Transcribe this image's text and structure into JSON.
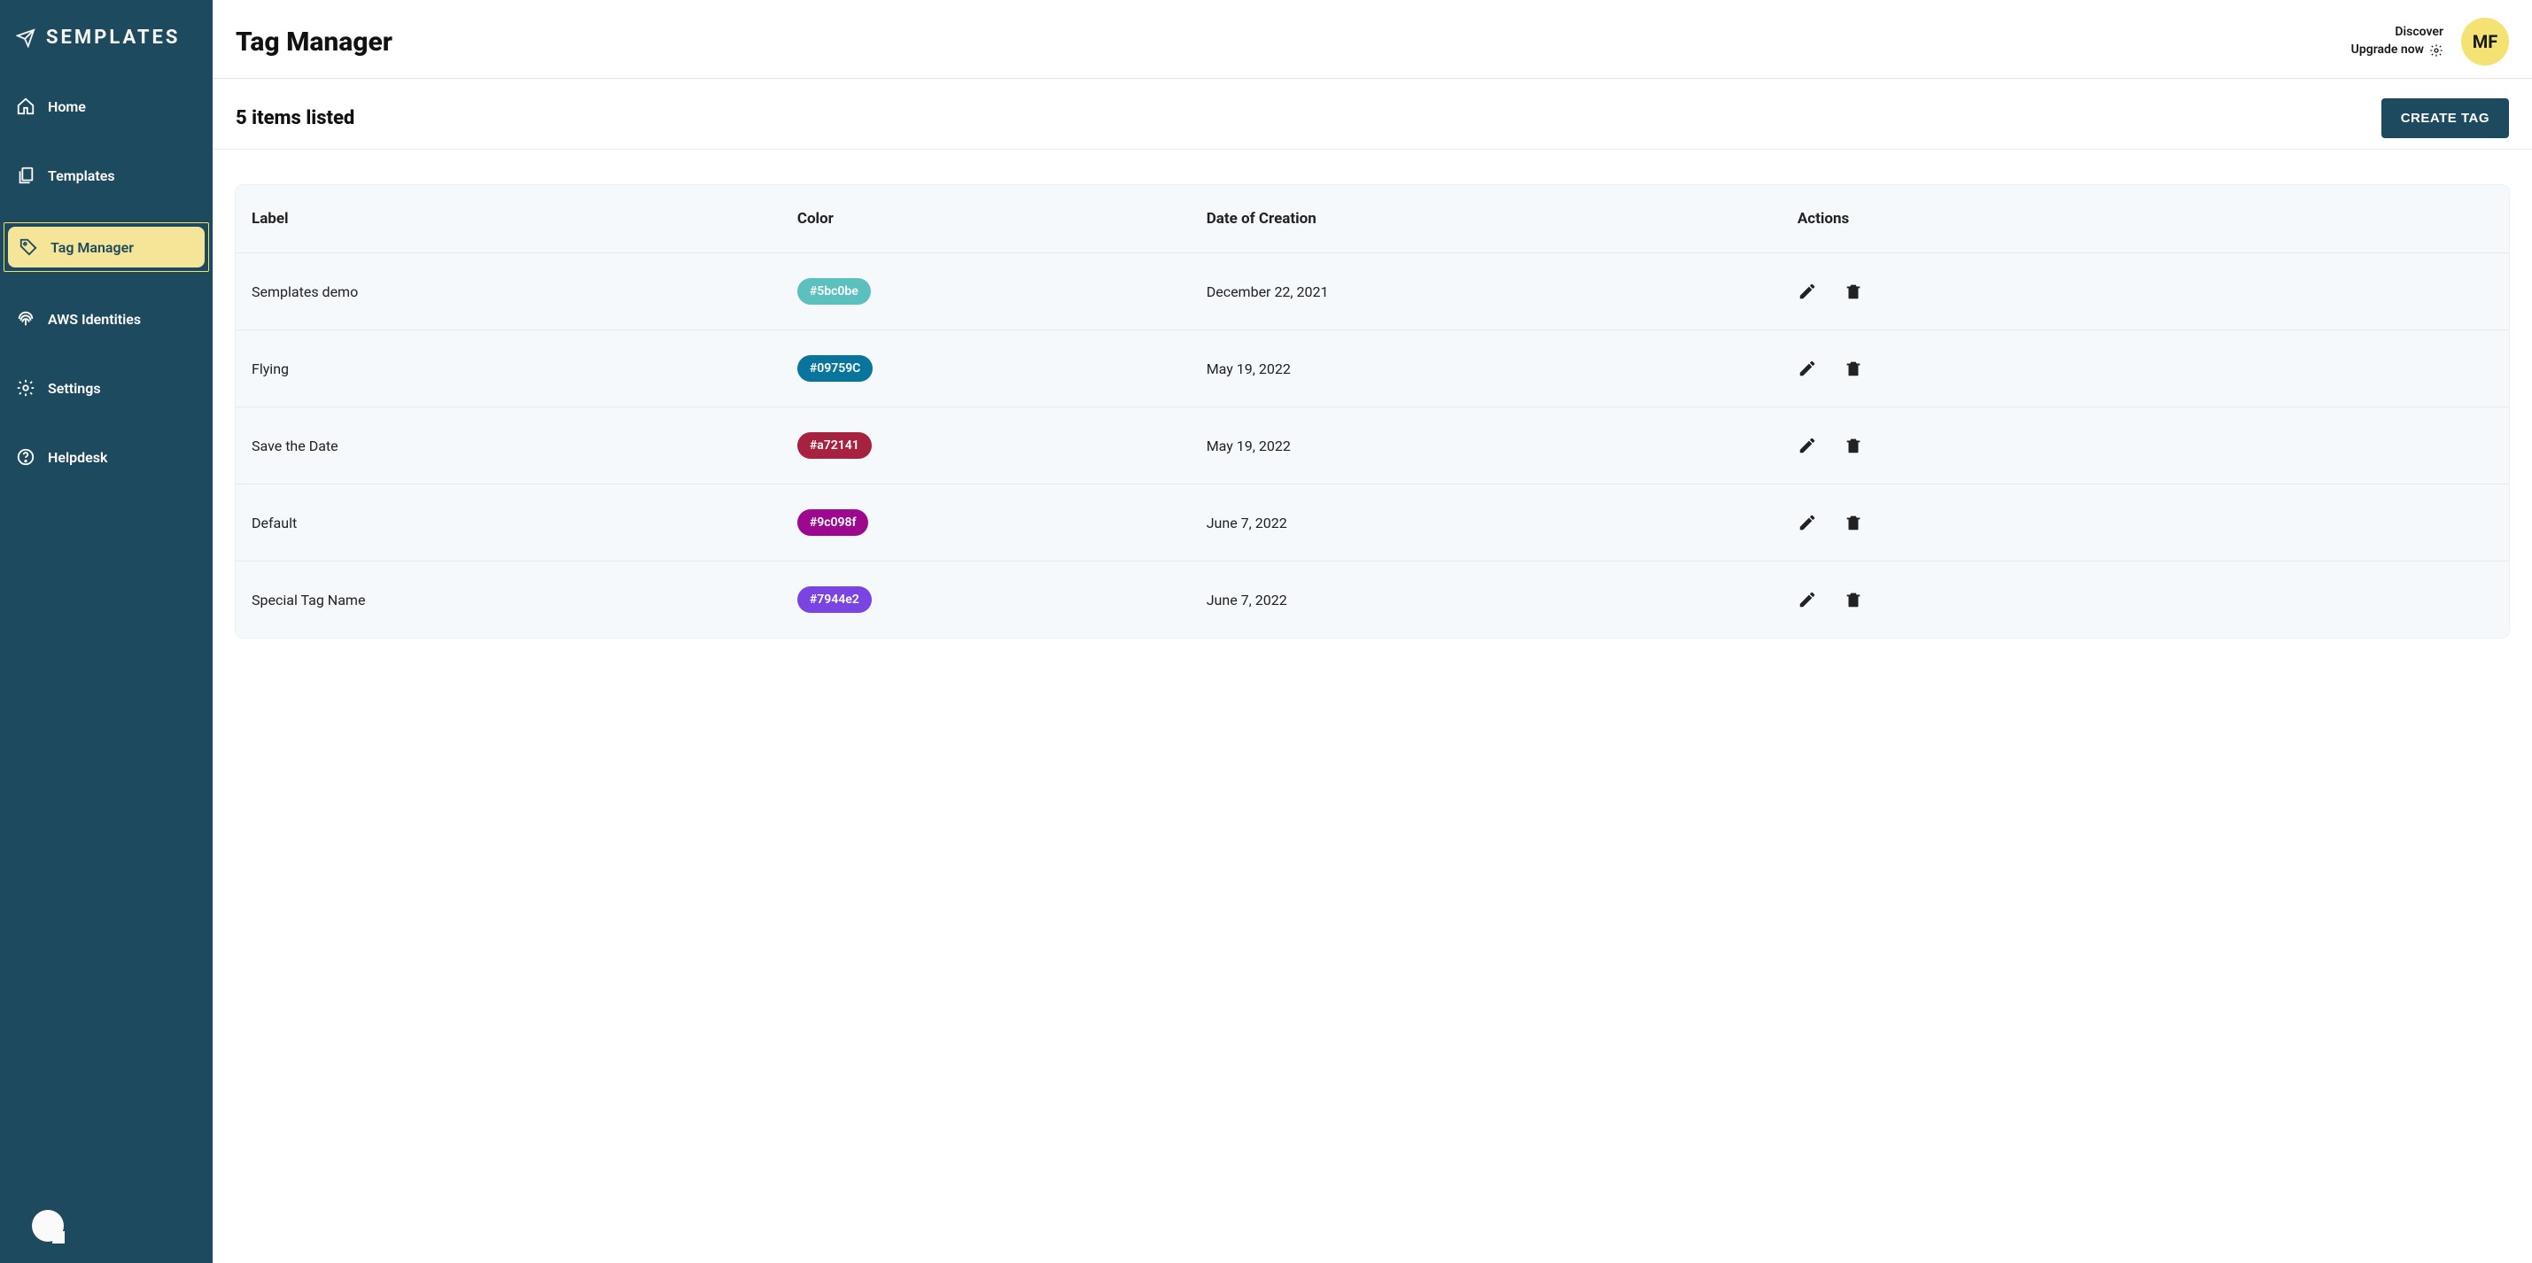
{
  "brand": "SEMPLATES",
  "sidebar": {
    "items": [
      {
        "id": "home",
        "label": "Home",
        "icon": "home-icon",
        "active": false
      },
      {
        "id": "templates",
        "label": "Templates",
        "icon": "templates-icon",
        "active": false
      },
      {
        "id": "tag-manager",
        "label": "Tag Manager",
        "icon": "tag-icon",
        "active": true
      },
      {
        "id": "aws-identities",
        "label": "AWS Identities",
        "icon": "fingerprint-icon",
        "active": false
      },
      {
        "id": "settings",
        "label": "Settings",
        "icon": "gear-icon",
        "active": false
      },
      {
        "id": "helpdesk",
        "label": "Helpdesk",
        "icon": "help-icon",
        "active": false
      }
    ]
  },
  "header": {
    "page_title": "Tag Manager",
    "discover_label": "Discover",
    "upgrade_label": "Upgrade now",
    "avatar_initials": "MF"
  },
  "subheader": {
    "items_listed_label": "5 items listed",
    "create_button_label": "CREATE TAG"
  },
  "table": {
    "columns": {
      "label": "Label",
      "color": "Color",
      "date": "Date of Creation",
      "actions": "Actions"
    },
    "rows": [
      {
        "label": "Semplates demo",
        "color_hex": "#5bc0be",
        "color_text": "#5bc0be",
        "date": "December 22, 2021"
      },
      {
        "label": "Flying",
        "color_hex": "#09759C",
        "color_text": "#09759C",
        "date": "May 19, 2022"
      },
      {
        "label": "Save the Date",
        "color_hex": "#a72141",
        "color_text": "#a72141",
        "date": "May 19, 2022"
      },
      {
        "label": "Default",
        "color_hex": "#9c098f",
        "color_text": "#9c098f",
        "date": "June 7, 2022"
      },
      {
        "label": "Special Tag Name",
        "color_hex": "#7944e2",
        "color_text": "#7944e2",
        "date": "June 7, 2022"
      }
    ]
  }
}
